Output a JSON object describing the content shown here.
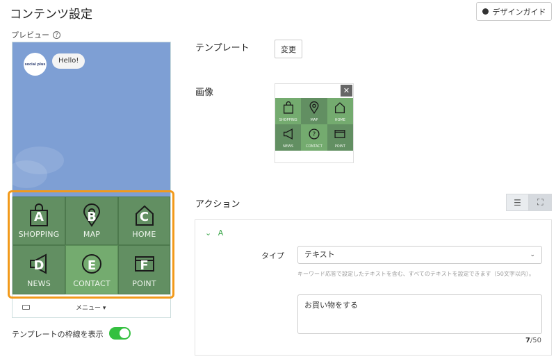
{
  "header": {
    "title": "コンテンツ設定",
    "guide_button": "デザインガイド"
  },
  "preview": {
    "label": "プレビュー",
    "avatar_text": "social plus",
    "bubble_text": "Hello!",
    "cells": [
      {
        "letter": "A",
        "label": "SHOPPING",
        "icon": "shopping-bag-icon"
      },
      {
        "letter": "B",
        "label": "MAP",
        "icon": "map-pin-icon"
      },
      {
        "letter": "C",
        "label": "HOME",
        "icon": "home-icon"
      },
      {
        "letter": "D",
        "label": "NEWS",
        "icon": "megaphone-icon"
      },
      {
        "letter": "E",
        "label": "CONTACT",
        "icon": "question-icon"
      },
      {
        "letter": "F",
        "label": "POINT",
        "icon": "point-card-icon"
      }
    ],
    "menu_label": "メニュー ▾",
    "toggle_label": "テンプレートの枠線を表示",
    "toggle_on": true
  },
  "template": {
    "title": "テンプレート",
    "change_button": "変更"
  },
  "image": {
    "title": "画像",
    "close": "✕",
    "cells": [
      {
        "label": "SHOPPING"
      },
      {
        "label": "MAP"
      },
      {
        "label": "HOME"
      },
      {
        "label": "NEWS"
      },
      {
        "label": "CONTACT"
      },
      {
        "label": "POINT"
      }
    ]
  },
  "action": {
    "title": "アクション",
    "list_view_icon": "☰",
    "expand_view_icon": "⛶",
    "accordion_label": "A",
    "type_label": "タイプ",
    "type_value": "テキスト",
    "hint": "キーワード応答で設定したテキストを含む、すべてのテキストを設定できます（50文字以内）。",
    "text_value": "お買い物をする",
    "counter_current": "7",
    "counter_max": "/50"
  },
  "colors": {
    "accent_green": "#3aa549",
    "highlight_orange": "#f29a1b",
    "toggle_green": "#34c040"
  }
}
